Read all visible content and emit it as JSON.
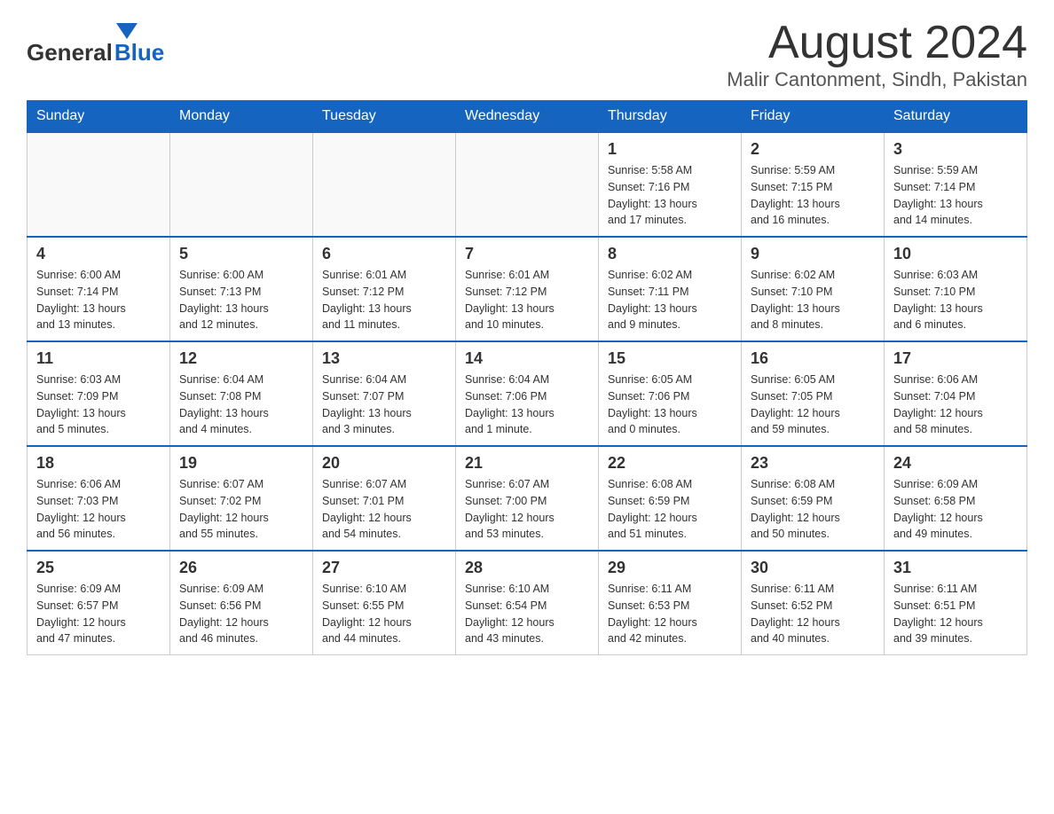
{
  "header": {
    "logo_general": "General",
    "logo_blue": "Blue",
    "title": "August 2024",
    "subtitle": "Malir Cantonment, Sindh, Pakistan"
  },
  "days_of_week": [
    "Sunday",
    "Monday",
    "Tuesday",
    "Wednesday",
    "Thursday",
    "Friday",
    "Saturday"
  ],
  "weeks": [
    [
      {
        "day": "",
        "info": ""
      },
      {
        "day": "",
        "info": ""
      },
      {
        "day": "",
        "info": ""
      },
      {
        "day": "",
        "info": ""
      },
      {
        "day": "1",
        "info": "Sunrise: 5:58 AM\nSunset: 7:16 PM\nDaylight: 13 hours\nand 17 minutes."
      },
      {
        "day": "2",
        "info": "Sunrise: 5:59 AM\nSunset: 7:15 PM\nDaylight: 13 hours\nand 16 minutes."
      },
      {
        "day": "3",
        "info": "Sunrise: 5:59 AM\nSunset: 7:14 PM\nDaylight: 13 hours\nand 14 minutes."
      }
    ],
    [
      {
        "day": "4",
        "info": "Sunrise: 6:00 AM\nSunset: 7:14 PM\nDaylight: 13 hours\nand 13 minutes."
      },
      {
        "day": "5",
        "info": "Sunrise: 6:00 AM\nSunset: 7:13 PM\nDaylight: 13 hours\nand 12 minutes."
      },
      {
        "day": "6",
        "info": "Sunrise: 6:01 AM\nSunset: 7:12 PM\nDaylight: 13 hours\nand 11 minutes."
      },
      {
        "day": "7",
        "info": "Sunrise: 6:01 AM\nSunset: 7:12 PM\nDaylight: 13 hours\nand 10 minutes."
      },
      {
        "day": "8",
        "info": "Sunrise: 6:02 AM\nSunset: 7:11 PM\nDaylight: 13 hours\nand 9 minutes."
      },
      {
        "day": "9",
        "info": "Sunrise: 6:02 AM\nSunset: 7:10 PM\nDaylight: 13 hours\nand 8 minutes."
      },
      {
        "day": "10",
        "info": "Sunrise: 6:03 AM\nSunset: 7:10 PM\nDaylight: 13 hours\nand 6 minutes."
      }
    ],
    [
      {
        "day": "11",
        "info": "Sunrise: 6:03 AM\nSunset: 7:09 PM\nDaylight: 13 hours\nand 5 minutes."
      },
      {
        "day": "12",
        "info": "Sunrise: 6:04 AM\nSunset: 7:08 PM\nDaylight: 13 hours\nand 4 minutes."
      },
      {
        "day": "13",
        "info": "Sunrise: 6:04 AM\nSunset: 7:07 PM\nDaylight: 13 hours\nand 3 minutes."
      },
      {
        "day": "14",
        "info": "Sunrise: 6:04 AM\nSunset: 7:06 PM\nDaylight: 13 hours\nand 1 minute."
      },
      {
        "day": "15",
        "info": "Sunrise: 6:05 AM\nSunset: 7:06 PM\nDaylight: 13 hours\nand 0 minutes."
      },
      {
        "day": "16",
        "info": "Sunrise: 6:05 AM\nSunset: 7:05 PM\nDaylight: 12 hours\nand 59 minutes."
      },
      {
        "day": "17",
        "info": "Sunrise: 6:06 AM\nSunset: 7:04 PM\nDaylight: 12 hours\nand 58 minutes."
      }
    ],
    [
      {
        "day": "18",
        "info": "Sunrise: 6:06 AM\nSunset: 7:03 PM\nDaylight: 12 hours\nand 56 minutes."
      },
      {
        "day": "19",
        "info": "Sunrise: 6:07 AM\nSunset: 7:02 PM\nDaylight: 12 hours\nand 55 minutes."
      },
      {
        "day": "20",
        "info": "Sunrise: 6:07 AM\nSunset: 7:01 PM\nDaylight: 12 hours\nand 54 minutes."
      },
      {
        "day": "21",
        "info": "Sunrise: 6:07 AM\nSunset: 7:00 PM\nDaylight: 12 hours\nand 53 minutes."
      },
      {
        "day": "22",
        "info": "Sunrise: 6:08 AM\nSunset: 6:59 PM\nDaylight: 12 hours\nand 51 minutes."
      },
      {
        "day": "23",
        "info": "Sunrise: 6:08 AM\nSunset: 6:59 PM\nDaylight: 12 hours\nand 50 minutes."
      },
      {
        "day": "24",
        "info": "Sunrise: 6:09 AM\nSunset: 6:58 PM\nDaylight: 12 hours\nand 49 minutes."
      }
    ],
    [
      {
        "day": "25",
        "info": "Sunrise: 6:09 AM\nSunset: 6:57 PM\nDaylight: 12 hours\nand 47 minutes."
      },
      {
        "day": "26",
        "info": "Sunrise: 6:09 AM\nSunset: 6:56 PM\nDaylight: 12 hours\nand 46 minutes."
      },
      {
        "day": "27",
        "info": "Sunrise: 6:10 AM\nSunset: 6:55 PM\nDaylight: 12 hours\nand 44 minutes."
      },
      {
        "day": "28",
        "info": "Sunrise: 6:10 AM\nSunset: 6:54 PM\nDaylight: 12 hours\nand 43 minutes."
      },
      {
        "day": "29",
        "info": "Sunrise: 6:11 AM\nSunset: 6:53 PM\nDaylight: 12 hours\nand 42 minutes."
      },
      {
        "day": "30",
        "info": "Sunrise: 6:11 AM\nSunset: 6:52 PM\nDaylight: 12 hours\nand 40 minutes."
      },
      {
        "day": "31",
        "info": "Sunrise: 6:11 AM\nSunset: 6:51 PM\nDaylight: 12 hours\nand 39 minutes."
      }
    ]
  ]
}
